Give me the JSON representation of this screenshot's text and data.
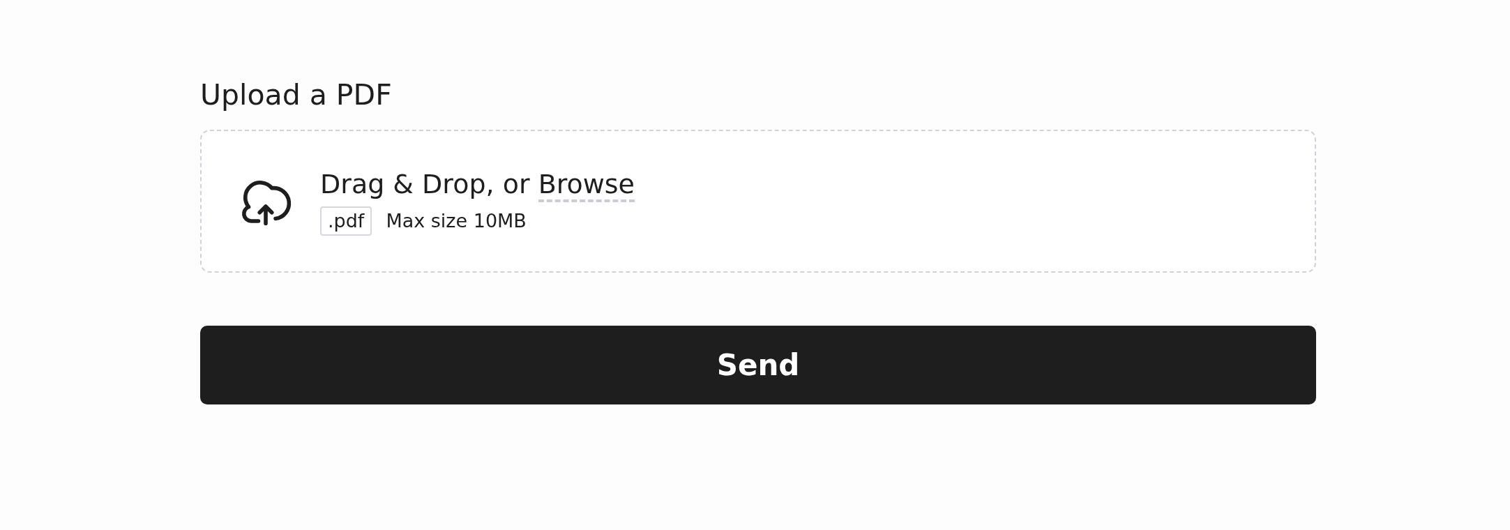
{
  "heading": "Upload a PDF",
  "drop_zone": {
    "prompt": "Drag & Drop, or",
    "link": "Browse",
    "file_type": ".pdf",
    "max_size": "Max size 10MB"
  },
  "submit_button": {
    "label": "Send"
  }
}
